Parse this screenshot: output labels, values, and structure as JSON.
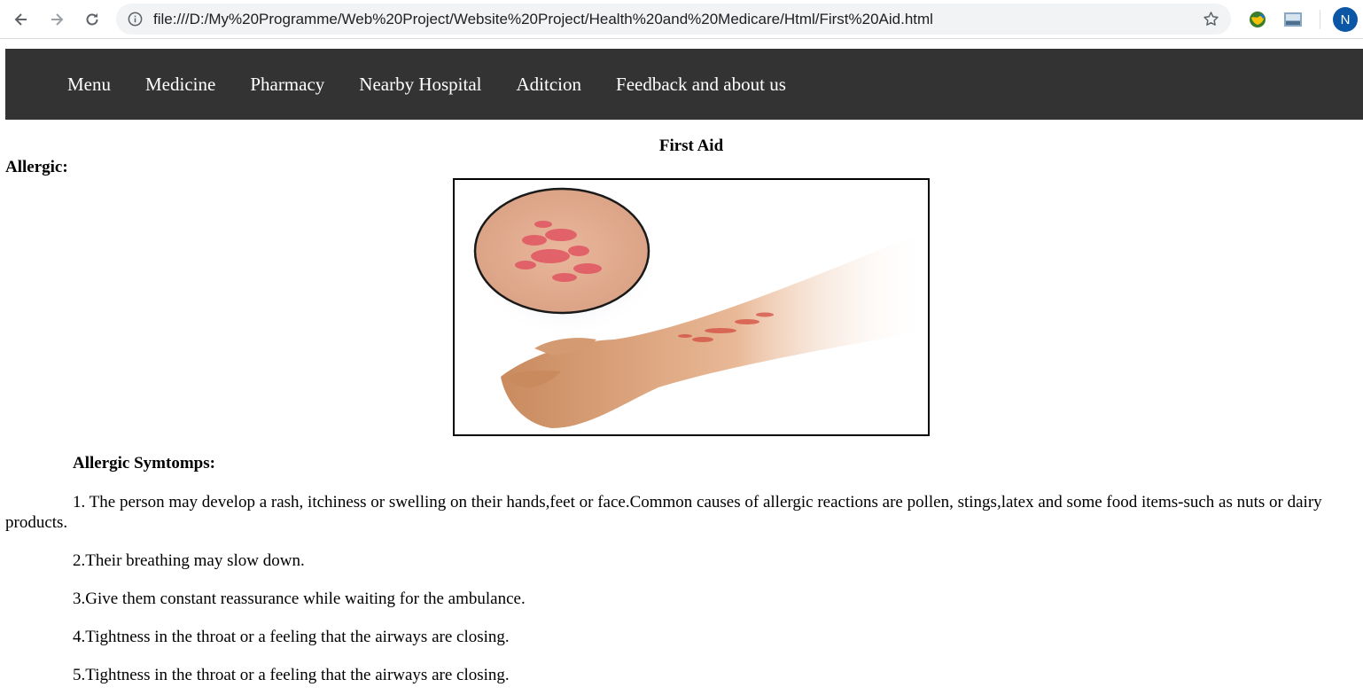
{
  "browser": {
    "url": "file:///D:/My%20Programme/Web%20Project/Website%20Project/Health%20and%20Medicare/Html/First%20Aid.html",
    "profile_initial": "N",
    "icons": [
      "back-arrow-icon",
      "forward-arrow-icon",
      "reload-icon",
      "info-icon",
      "star-icon",
      "globe-extension-icon",
      "image-extension-icon"
    ]
  },
  "nav": {
    "items": [
      {
        "label": "Menu"
      },
      {
        "label": "Medicine"
      },
      {
        "label": "Pharmacy"
      },
      {
        "label": "Nearby Hospital"
      },
      {
        "label": "Aditcion"
      },
      {
        "label": "Feedback and about us"
      }
    ]
  },
  "content": {
    "title": "First Aid",
    "section_heading": "Allergic:",
    "symptoms_heading": "Allergic Symtomps:",
    "items": [
      "1. The person may develop a rash, itchiness or swelling on their hands,feet or face.Common causes of allergic reactions are pollen, stings,latex and some food items-such as nuts or dairy products.",
      "2.Their breathing may slow down.",
      "3.Give them constant reassurance while waiting for the ambulance.",
      "4.Tightness in the throat or a feeling that the airways are closing.",
      "5.Tightness in the throat or a feeling that the airways are closing."
    ]
  },
  "colors": {
    "navbar_bg": "#333333",
    "nav_text": "#ffffff",
    "avatar_bg": "#0b57a5"
  }
}
